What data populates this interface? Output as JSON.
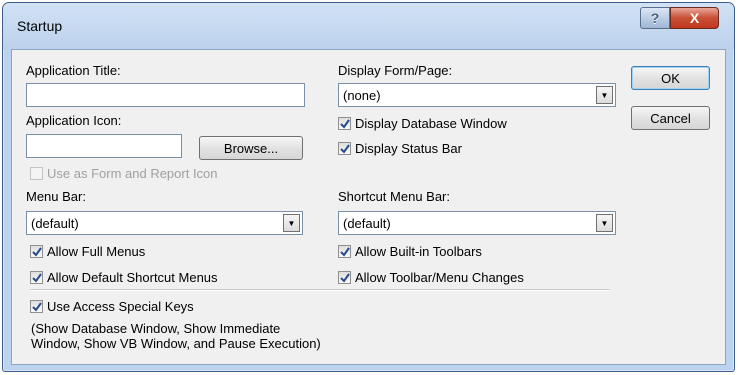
{
  "window": {
    "title": "Startup"
  },
  "titlebar": {
    "help_label": "?",
    "close_label": "X"
  },
  "app_title": {
    "label": "Application Title:",
    "value": ""
  },
  "app_icon": {
    "label": "Application Icon:",
    "value": "",
    "browse_label": "Browse...",
    "use_as_icon_label": "Use as Form and Report Icon",
    "use_as_icon_checked": false,
    "use_as_icon_enabled": false
  },
  "display_form": {
    "label": "Display Form/Page:",
    "value": "(none)"
  },
  "display_db_window": {
    "label": "Display Database Window",
    "checked": true
  },
  "display_status_bar": {
    "label": "Display Status Bar",
    "checked": true
  },
  "menu_bar": {
    "label": "Menu Bar:",
    "value": "(default)"
  },
  "shortcut_menu_bar": {
    "label": "Shortcut Menu Bar:",
    "value": "(default)"
  },
  "allow_full_menus": {
    "label": "Allow Full Menus",
    "checked": true
  },
  "allow_default_shortcut": {
    "label": "Allow Default Shortcut Menus",
    "checked": true
  },
  "allow_builtin_toolbars": {
    "label": "Allow Built-in Toolbars",
    "checked": true
  },
  "allow_toolbar_changes": {
    "label": "Allow Toolbar/Menu Changes",
    "checked": true
  },
  "use_special_keys": {
    "label": "Use Access Special Keys",
    "checked": true
  },
  "special_keys_note": {
    "line1": "(Show Database Window, Show Immediate",
    "line2": "Window, Show VB Window, and Pause Execution)"
  },
  "buttons": {
    "ok": "OK",
    "cancel": "Cancel"
  },
  "icons": {
    "dropdown": "chevron-down-icon",
    "check": "checkmark-icon"
  }
}
